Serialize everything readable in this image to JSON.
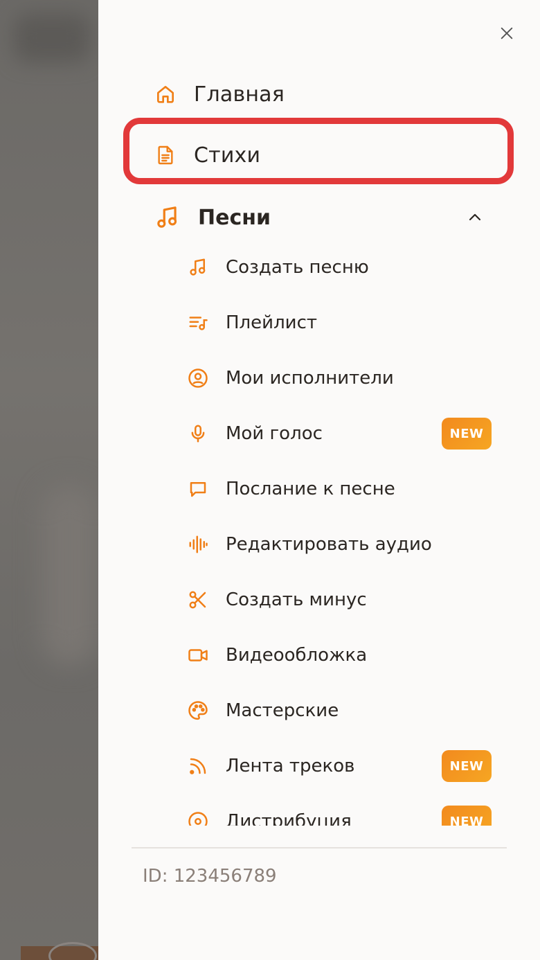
{
  "colors": {
    "accent": "#f07f17",
    "highlight": "#e2393a",
    "badge": "#f28a1e",
    "text": "#2b2622",
    "muted": "#8a7f78"
  },
  "drawer": {
    "close_icon": "close-icon",
    "top_items": [
      {
        "label": "Главная",
        "icon": "home-icon"
      },
      {
        "label": "Стихи",
        "icon": "document-icon"
      }
    ],
    "section": {
      "label": "Песни",
      "icon": "music-note-icon",
      "expanded": true,
      "items": [
        {
          "label": "Создать песню",
          "icon": "music-note-icon"
        },
        {
          "label": "Плейлист",
          "icon": "playlist-icon"
        },
        {
          "label": "Мои исполнители",
          "icon": "user-circle-icon"
        },
        {
          "label": "Мой голос",
          "icon": "microphone-icon",
          "badge": "NEW"
        },
        {
          "label": "Послание к песне",
          "icon": "message-icon"
        },
        {
          "label": "Редактировать аудио",
          "icon": "waveform-icon"
        },
        {
          "label": "Создать минус",
          "icon": "scissors-icon"
        },
        {
          "label": "Видеообложка",
          "icon": "video-icon"
        },
        {
          "label": "Мастерские",
          "icon": "palette-icon"
        },
        {
          "label": "Лента треков",
          "icon": "rss-icon",
          "badge": "NEW"
        },
        {
          "label": "Дистрибуция",
          "icon": "disc-icon",
          "badge": "NEW"
        }
      ]
    },
    "footer": {
      "user_id": "ID: 123456789"
    }
  }
}
